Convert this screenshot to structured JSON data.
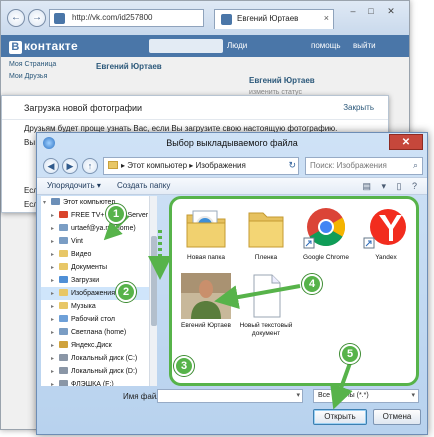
{
  "browser": {
    "address": "http://vk.com/id257800",
    "tab_title": "Евгений Юртаев",
    "back": "←",
    "forward": "→",
    "minimize": "–",
    "maximize": "□",
    "close": "✕",
    "tab_close": "×"
  },
  "vk": {
    "logo": "контакте",
    "logo_letter": "В",
    "search_label": "Люди",
    "top_links": [
      "помощь",
      "выйти"
    ],
    "left_menu": [
      "Моя Страница",
      "Мои Друзья"
    ],
    "profile_name": "Евгений Юртаев",
    "profile_name2": "Евгений Юртаев",
    "status": "изменить статус"
  },
  "upload_dialog": {
    "title": "Загрузка новой фотографии",
    "close": "Закрыть",
    "body": "Друзьям будет проще узнать Вас, если Вы загрузите свою настоящую фотографию.",
    "vy": "Вы",
    "esl1": "Есл",
    "esl2": "Есл"
  },
  "file_dialog": {
    "title": "Выбор выкладываемого файла",
    "close": "✕",
    "nav": {
      "back": "◀",
      "forward": "▶",
      "up": "↑"
    },
    "breadcrumb": "▸ Этот компьютер ▸ Изображения",
    "refresh": "↻",
    "search_placeholder": "Поиск: Изображения",
    "search_icon": "⌕",
    "organize": "Упорядочить ▾",
    "new_folder": "Создать папку",
    "view_icons": "▤ ▾ ▯ ?",
    "tree": [
      {
        "label": "Этот компьютер",
        "icon": "computer",
        "color": "#6c8fb8"
      },
      {
        "label": "FREE TV+ Media Server",
        "icon": "media",
        "color": "#d9442b"
      },
      {
        "label": "urtaef@ya.ru (home)",
        "icon": "user",
        "color": "#7a9dc4"
      },
      {
        "label": "Vint",
        "icon": "user",
        "color": "#7a9dc4"
      },
      {
        "label": "Видео",
        "icon": "folder",
        "color": "#e8c767"
      },
      {
        "label": "Документы",
        "icon": "folder",
        "color": "#e8c767"
      },
      {
        "label": "Загрузки",
        "icon": "folder",
        "color": "#4f8fd6"
      },
      {
        "label": "Изображения",
        "icon": "folder",
        "color": "#e8c767"
      },
      {
        "label": "Музыка",
        "icon": "folder",
        "color": "#e8c767"
      },
      {
        "label": "Рабочий стол",
        "icon": "folder",
        "color": "#6ea0d8"
      },
      {
        "label": "Светлана (home)",
        "icon": "user",
        "color": "#7a9dc4"
      },
      {
        "label": "Яндекс.Диск",
        "icon": "disk",
        "color": "#cfa23c"
      },
      {
        "label": "Локальный диск (C:)",
        "icon": "drive",
        "color": "#8a96a6"
      },
      {
        "label": "Локальный диск (D:)",
        "icon": "drive",
        "color": "#8a96a6"
      },
      {
        "label": "ФЛЭШКА (F:)",
        "icon": "usb",
        "color": "#8a96a6"
      }
    ],
    "files": [
      {
        "label": "Новая папка"
      },
      {
        "label": "Пленка"
      },
      {
        "label": "Google Chrome"
      },
      {
        "label": "Yandex"
      },
      {
        "label": "Евгений Юртаев"
      },
      {
        "label": "Новый текстовый документ"
      }
    ],
    "filename_label": "Имя файла:",
    "filetype": "Все файлы (*.*)",
    "open": "Открыть",
    "cancel": "Отмена"
  },
  "steps": [
    "1",
    "2",
    "3",
    "4",
    "5"
  ],
  "colors": {
    "step_green": "#57b34a",
    "vk_blue": "#4a76a8",
    "close_red": "#c6473b"
  }
}
